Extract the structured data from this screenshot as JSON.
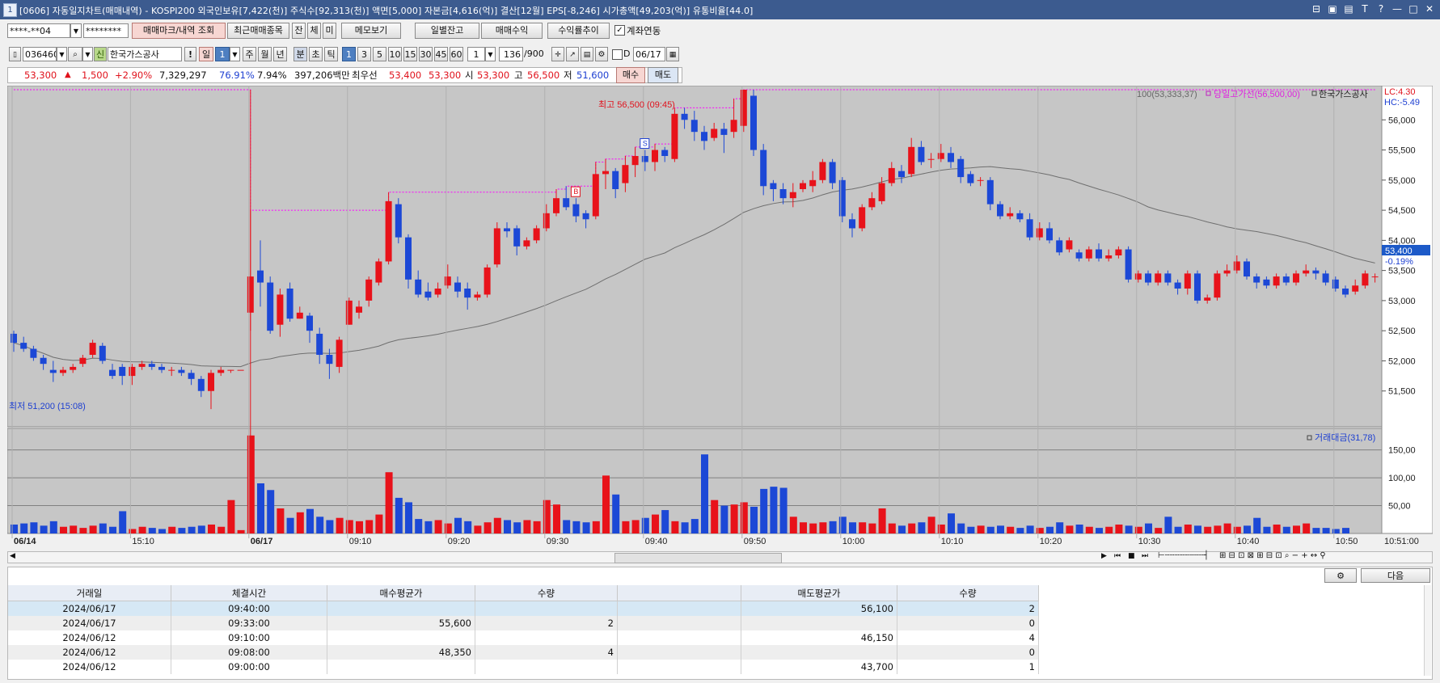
{
  "window": {
    "title": "[0606] 자동일지차트(매매내역) - KOSPI200 외국인보유[7,422(천)] 주식수[92,313(천)] 액면[5,000] 자본금[4,616(억)] 결산[12월] EPS[-8,246] 시가총액[49,203(억)] 유통비율[44.0]",
    "icon_label": "1"
  },
  "toolbar1": {
    "account": "****-**04",
    "password": "********",
    "btn_trade_marks": "매매마크/내역 조회",
    "btn_recent_items": "최근매매종목",
    "btn_jan": "잔",
    "btn_che": "체",
    "btn_mi": "미",
    "btn_memo": "메모보기",
    "btn_daily_balance": "일별잔고",
    "btn_trade_profit": "매매수익",
    "btn_profit_trend": "수익률추이",
    "chk_account_link": "계좌연동"
  },
  "toolbar2": {
    "code": "036460",
    "sin": "신",
    "name": "한국가스공사",
    "excl": "!",
    "period_day": "일",
    "period_num": "1",
    "p_week": "주",
    "p_month": "월",
    "p_year": "년",
    "p_min": "분",
    "p_sec": "초",
    "p_tick": "틱",
    "minutes": [
      "1",
      "3",
      "5",
      "10",
      "15",
      "30",
      "45",
      "60"
    ],
    "unit": "1",
    "count": "136",
    "count_total": "/900",
    "d_label": "D",
    "date": "06/17"
  },
  "quote": {
    "price": "53,300",
    "arrow": "▲",
    "change": "1,500",
    "pct": "+2.90%",
    "volume": "7,329,297",
    "ratio1": "76.91%",
    "ratio2": "7.94%",
    "amount": "397,206백만",
    "best_label": "최우선",
    "best_ask": "53,400",
    "best_bid": "53,300",
    "open_label": "시",
    "open": "53,300",
    "high_label": "고",
    "high": "56,500",
    "low_label": "저",
    "low": "51,600",
    "buy_btn": "매수",
    "sell_btn": "매도"
  },
  "chart_labels": {
    "ma_legend": "100(53,333,37)",
    "high_line_legend": "당일고가선(56,500,00)",
    "name_legend": "한국가스공사",
    "lc": "LC:4.30",
    "hc": "HC:-5.49",
    "high_annot": "최고 56,500 (09:45)",
    "low_annot": "최저 51,200 (15:08)",
    "cur_price": "53,400",
    "cur_pct": "-0.19%",
    "vol_legend": "거래대금(31,78)",
    "marker_s": "S",
    "marker_b": "B",
    "date_start": "06/14",
    "date_mid": "06/17",
    "time_end": "10:51:00"
  },
  "chart_data": {
    "type": "candlestick",
    "price_ticks": [
      51500,
      52000,
      52500,
      53000,
      53500,
      54000,
      54500,
      55000,
      55500,
      56000
    ],
    "price_tick_labels": [
      "51,500",
      "52,000",
      "52,500",
      "53,000",
      "53,500",
      "54,000",
      "54,500",
      "55,000",
      "55,500",
      "56,000"
    ],
    "ylim": [
      51000,
      56500
    ],
    "volume_ticks": [
      50,
      100,
      150
    ],
    "volume_tick_labels": [
      "50,00",
      "100,00",
      "150,00"
    ],
    "volume_ylim": [
      0,
      180
    ],
    "time_labels": [
      "06/14",
      "15:10",
      "06/17",
      "09:10",
      "09:20",
      "09:30",
      "09:40",
      "09:50",
      "10:00",
      "10:10",
      "10:20",
      "10:30",
      "10:40",
      "10:50"
    ],
    "time_label_index": [
      0,
      12,
      24,
      34,
      44,
      54,
      64,
      74,
      84,
      94,
      104,
      114,
      124,
      134
    ],
    "candles": [
      [
        52450,
        52300,
        52500,
        52150
      ],
      [
        52300,
        52200,
        52400,
        52150
      ],
      [
        52200,
        52050,
        52250,
        52000
      ],
      [
        52050,
        51950,
        52100,
        51850
      ],
      [
        51850,
        51800,
        52000,
        51650
      ],
      [
        51800,
        51850,
        51900,
        51750
      ],
      [
        51850,
        51900,
        51950,
        51800
      ],
      [
        51950,
        52050,
        52100,
        51900
      ],
      [
        52100,
        52300,
        52350,
        52050
      ],
      [
        52250,
        52000,
        52300,
        51950
      ],
      [
        51850,
        51750,
        51950,
        51700
      ],
      [
        51900,
        51750,
        51950,
        51600
      ],
      [
        51750,
        51900,
        51950,
        51600
      ],
      [
        51900,
        51950,
        52000,
        51850
      ],
      [
        51950,
        51900,
        52000,
        51850
      ],
      [
        51900,
        51850,
        51950,
        51800
      ],
      [
        51850,
        51850,
        51900,
        51750
      ],
      [
        51850,
        51800,
        51900,
        51750
      ],
      [
        51800,
        51700,
        51850,
        51600
      ],
      [
        51700,
        51500,
        51750,
        51400
      ],
      [
        51500,
        51800,
        51850,
        51200
      ],
      [
        51800,
        51850,
        51900,
        51750
      ],
      [
        51850,
        51850,
        51850,
        51800
      ],
      [
        51850,
        51850,
        51850,
        51850
      ],
      [
        52800,
        53400,
        54500,
        52500
      ],
      [
        53500,
        53300,
        54000,
        52900
      ],
      [
        53300,
        52500,
        53400,
        52450
      ],
      [
        52600,
        53100,
        53200,
        52400
      ],
      [
        53200,
        52700,
        53300,
        52650
      ],
      [
        52700,
        52800,
        52900,
        52700
      ],
      [
        52750,
        52500,
        52800,
        52300
      ],
      [
        52450,
        52100,
        52550,
        51950
      ],
      [
        52100,
        51950,
        52200,
        51700
      ],
      [
        51900,
        52350,
        52400,
        51800
      ],
      [
        52600,
        53000,
        53050,
        52600
      ],
      [
        52800,
        52900,
        53000,
        52700
      ],
      [
        53000,
        53350,
        53400,
        52900
      ],
      [
        53300,
        53650,
        53700,
        53250
      ],
      [
        53650,
        54650,
        54800,
        53600
      ],
      [
        54600,
        54050,
        54700,
        53950
      ],
      [
        54050,
        53350,
        54100,
        53200
      ],
      [
        53350,
        53100,
        53500,
        53050
      ],
      [
        53150,
        53050,
        53300,
        53000
      ],
      [
        53100,
        53200,
        53300,
        53050
      ],
      [
        53250,
        53400,
        53600,
        53200
      ],
      [
        53300,
        53150,
        53400,
        53050
      ],
      [
        53200,
        53050,
        53300,
        52850
      ],
      [
        53050,
        53100,
        53150,
        53000
      ],
      [
        53100,
        53550,
        53600,
        53050
      ],
      [
        53600,
        54200,
        54300,
        53550
      ],
      [
        54200,
        54150,
        54300,
        54050
      ],
      [
        54200,
        53900,
        54250,
        53750
      ],
      [
        53900,
        54000,
        54050,
        53850
      ],
      [
        54000,
        54200,
        54250,
        53950
      ],
      [
        54200,
        54450,
        54600,
        54150
      ],
      [
        54450,
        54700,
        54850,
        54400
      ],
      [
        54700,
        54550,
        54900,
        54500
      ],
      [
        54600,
        54400,
        54700,
        54300
      ],
      [
        54450,
        54350,
        54500,
        54200
      ],
      [
        54400,
        55100,
        55300,
        54350
      ],
      [
        55100,
        55150,
        55350,
        54850
      ],
      [
        55150,
        54850,
        55200,
        54700
      ],
      [
        54950,
        55250,
        55400,
        54800
      ],
      [
        55250,
        55400,
        55550,
        55050
      ],
      [
        55400,
        55300,
        55500,
        55150
      ],
      [
        55300,
        55500,
        55600,
        55150
      ],
      [
        55500,
        55400,
        55550,
        55300
      ],
      [
        55350,
        56100,
        56200,
        55300
      ],
      [
        56100,
        56000,
        56200,
        55850
      ],
      [
        56000,
        55800,
        56150,
        55650
      ],
      [
        55800,
        55650,
        55900,
        55500
      ],
      [
        55700,
        55850,
        55950,
        55650
      ],
      [
        55850,
        55750,
        55950,
        55450
      ],
      [
        55800,
        56000,
        56350,
        55700
      ],
      [
        55900,
        56500,
        56500,
        55800
      ],
      [
        56400,
        55500,
        56500,
        55400
      ],
      [
        55500,
        54900,
        55600,
        54750
      ],
      [
        54950,
        54850,
        55000,
        54650
      ],
      [
        54850,
        54700,
        54950,
        54600
      ],
      [
        54700,
        54800,
        54950,
        54550
      ],
      [
        54850,
        54950,
        55000,
        54800
      ],
      [
        54900,
        55000,
        55150,
        54800
      ],
      [
        55000,
        55300,
        55350,
        54950
      ],
      [
        55300,
        54950,
        55350,
        54850
      ],
      [
        55000,
        54400,
        55050,
        54300
      ],
      [
        54350,
        54200,
        54450,
        54050
      ],
      [
        54200,
        54550,
        54600,
        54150
      ],
      [
        54550,
        54700,
        54800,
        54500
      ],
      [
        54650,
        54950,
        55050,
        54600
      ],
      [
        54950,
        55200,
        55300,
        54900
      ],
      [
        55150,
        55050,
        55250,
        54950
      ],
      [
        55100,
        55550,
        55700,
        55050
      ],
      [
        55550,
        55300,
        55650,
        55250
      ],
      [
        55350,
        55350,
        55450,
        55200
      ],
      [
        55350,
        55450,
        55600,
        55300
      ],
      [
        55450,
        55300,
        55550,
        55200
      ],
      [
        55350,
        55050,
        55400,
        54950
      ],
      [
        55100,
        54950,
        55150,
        54900
      ],
      [
        55000,
        55000,
        55050,
        54900
      ],
      [
        55000,
        54600,
        55050,
        54500
      ],
      [
        54600,
        54400,
        54650,
        54350
      ],
      [
        54400,
        54450,
        54550,
        54350
      ],
      [
        54450,
        54350,
        54500,
        54300
      ],
      [
        54350,
        54050,
        54450,
        54000
      ],
      [
        54050,
        54200,
        54300,
        54000
      ],
      [
        54200,
        54000,
        54300,
        53950
      ],
      [
        54000,
        53800,
        54050,
        53750
      ],
      [
        53850,
        54000,
        54050,
        53800
      ],
      [
        53800,
        53700,
        53850,
        53650
      ],
      [
        53700,
        53850,
        53900,
        53650
      ],
      [
        53850,
        53700,
        53950,
        53650
      ],
      [
        53700,
        53750,
        53850,
        53650
      ],
      [
        53750,
        53850,
        53900,
        53700
      ],
      [
        53850,
        53350,
        53900,
        53300
      ],
      [
        53350,
        53450,
        53500,
        53300
      ],
      [
        53450,
        53300,
        53500,
        53250
      ],
      [
        53300,
        53450,
        53500,
        53250
      ],
      [
        53450,
        53300,
        53500,
        53250
      ],
      [
        53300,
        53200,
        53350,
        53100
      ],
      [
        53200,
        53450,
        53500,
        53100
      ],
      [
        53450,
        53000,
        53500,
        52950
      ],
      [
        53000,
        53050,
        53100,
        52950
      ],
      [
        53050,
        53450,
        53500,
        53000
      ],
      [
        53450,
        53500,
        53600,
        53400
      ],
      [
        53500,
        53650,
        53750,
        53450
      ],
      [
        53650,
        53400,
        53700,
        53350
      ],
      [
        53400,
        53300,
        53450,
        53200
      ],
      [
        53350,
        53250,
        53400,
        53200
      ],
      [
        53250,
        53400,
        53450,
        53200
      ],
      [
        53400,
        53300,
        53450,
        53250
      ],
      [
        53300,
        53450,
        53500,
        53250
      ],
      [
        53450,
        53500,
        53600,
        53400
      ],
      [
        53500,
        53450,
        53550,
        53350
      ],
      [
        53450,
        53300,
        53500,
        53250
      ],
      [
        53350,
        53200,
        53400,
        53150
      ],
      [
        53200,
        53100,
        53250,
        53050
      ],
      [
        53150,
        53250,
        53350,
        53100
      ],
      [
        53250,
        53450,
        53500,
        53200
      ],
      [
        53400,
        53400,
        53450,
        53300
      ]
    ],
    "volumes": [
      16,
      18,
      20,
      14,
      22,
      12,
      14,
      10,
      14,
      18,
      12,
      40,
      8,
      12,
      10,
      8,
      12,
      10,
      12,
      14,
      16,
      12,
      60,
      6,
      176,
      90,
      78,
      45,
      28,
      38,
      44,
      30,
      24,
      28,
      24,
      22,
      24,
      34,
      110,
      64,
      56,
      26,
      22,
      24,
      18,
      28,
      22,
      14,
      20,
      28,
      24,
      20,
      24,
      22,
      60,
      52,
      24,
      22,
      20,
      22,
      104,
      70,
      22,
      24,
      28,
      34,
      42,
      22,
      20,
      26,
      142,
      60,
      50,
      52,
      56,
      48,
      80,
      84,
      82,
      30,
      20,
      18,
      20,
      22,
      30,
      20,
      20,
      18,
      45,
      18,
      14,
      18,
      20,
      30,
      16,
      36,
      18,
      12,
      14,
      12,
      14,
      12,
      10,
      14,
      10,
      12,
      20,
      14,
      16,
      12,
      10,
      12,
      16,
      14,
      12,
      18,
      10,
      30,
      12,
      16,
      14,
      12,
      14,
      18,
      12,
      14,
      28,
      12,
      16,
      12,
      14,
      18,
      10,
      10,
      8,
      10
    ]
  },
  "table": {
    "headers": [
      "거래일",
      "체결시간",
      "매수평균가",
      "수량",
      "",
      "매도평균가",
      "수량"
    ],
    "rows": [
      [
        "2024/06/17",
        "09:40:00",
        "",
        "",
        "",
        "56,100",
        "2"
      ],
      [
        "2024/06/17",
        "09:33:00",
        "55,600",
        "2",
        "",
        "",
        "0"
      ],
      [
        "2024/06/12",
        "09:10:00",
        "",
        "",
        "",
        "46,150",
        "4"
      ],
      [
        "2024/06/12",
        "09:08:00",
        "48,350",
        "4",
        "",
        "",
        "0"
      ],
      [
        "2024/06/12",
        "09:00:00",
        "",
        "",
        "",
        "43,700",
        "1"
      ]
    ],
    "next_btn": "다음"
  },
  "colors": {
    "up": "#e8121a",
    "down": "#1c48d6",
    "chart_bg": "#c6c6c6",
    "title_bg": "#3c5b8f",
    "ma_line": "#6f6f6f",
    "high_line": "#ff00ff"
  }
}
